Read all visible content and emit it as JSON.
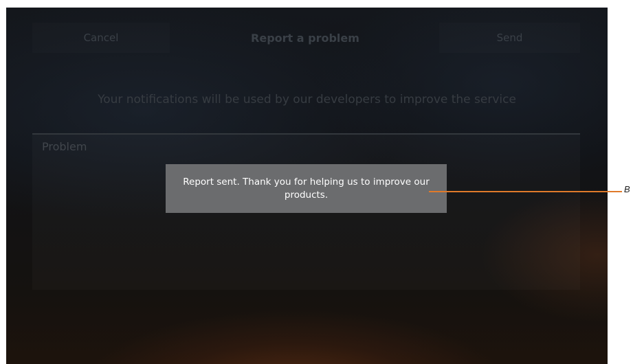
{
  "header": {
    "cancel_label": "Cancel",
    "title": "Report a problem",
    "send_label": "Send"
  },
  "subtitle": "Your notifications will be used by our developers to improve the service",
  "problem": {
    "label": "Problem"
  },
  "toast": {
    "message": "Report sent. Thank you for helping us to improve our products."
  },
  "callout": {
    "label": "B",
    "color": "#e07a2a"
  }
}
